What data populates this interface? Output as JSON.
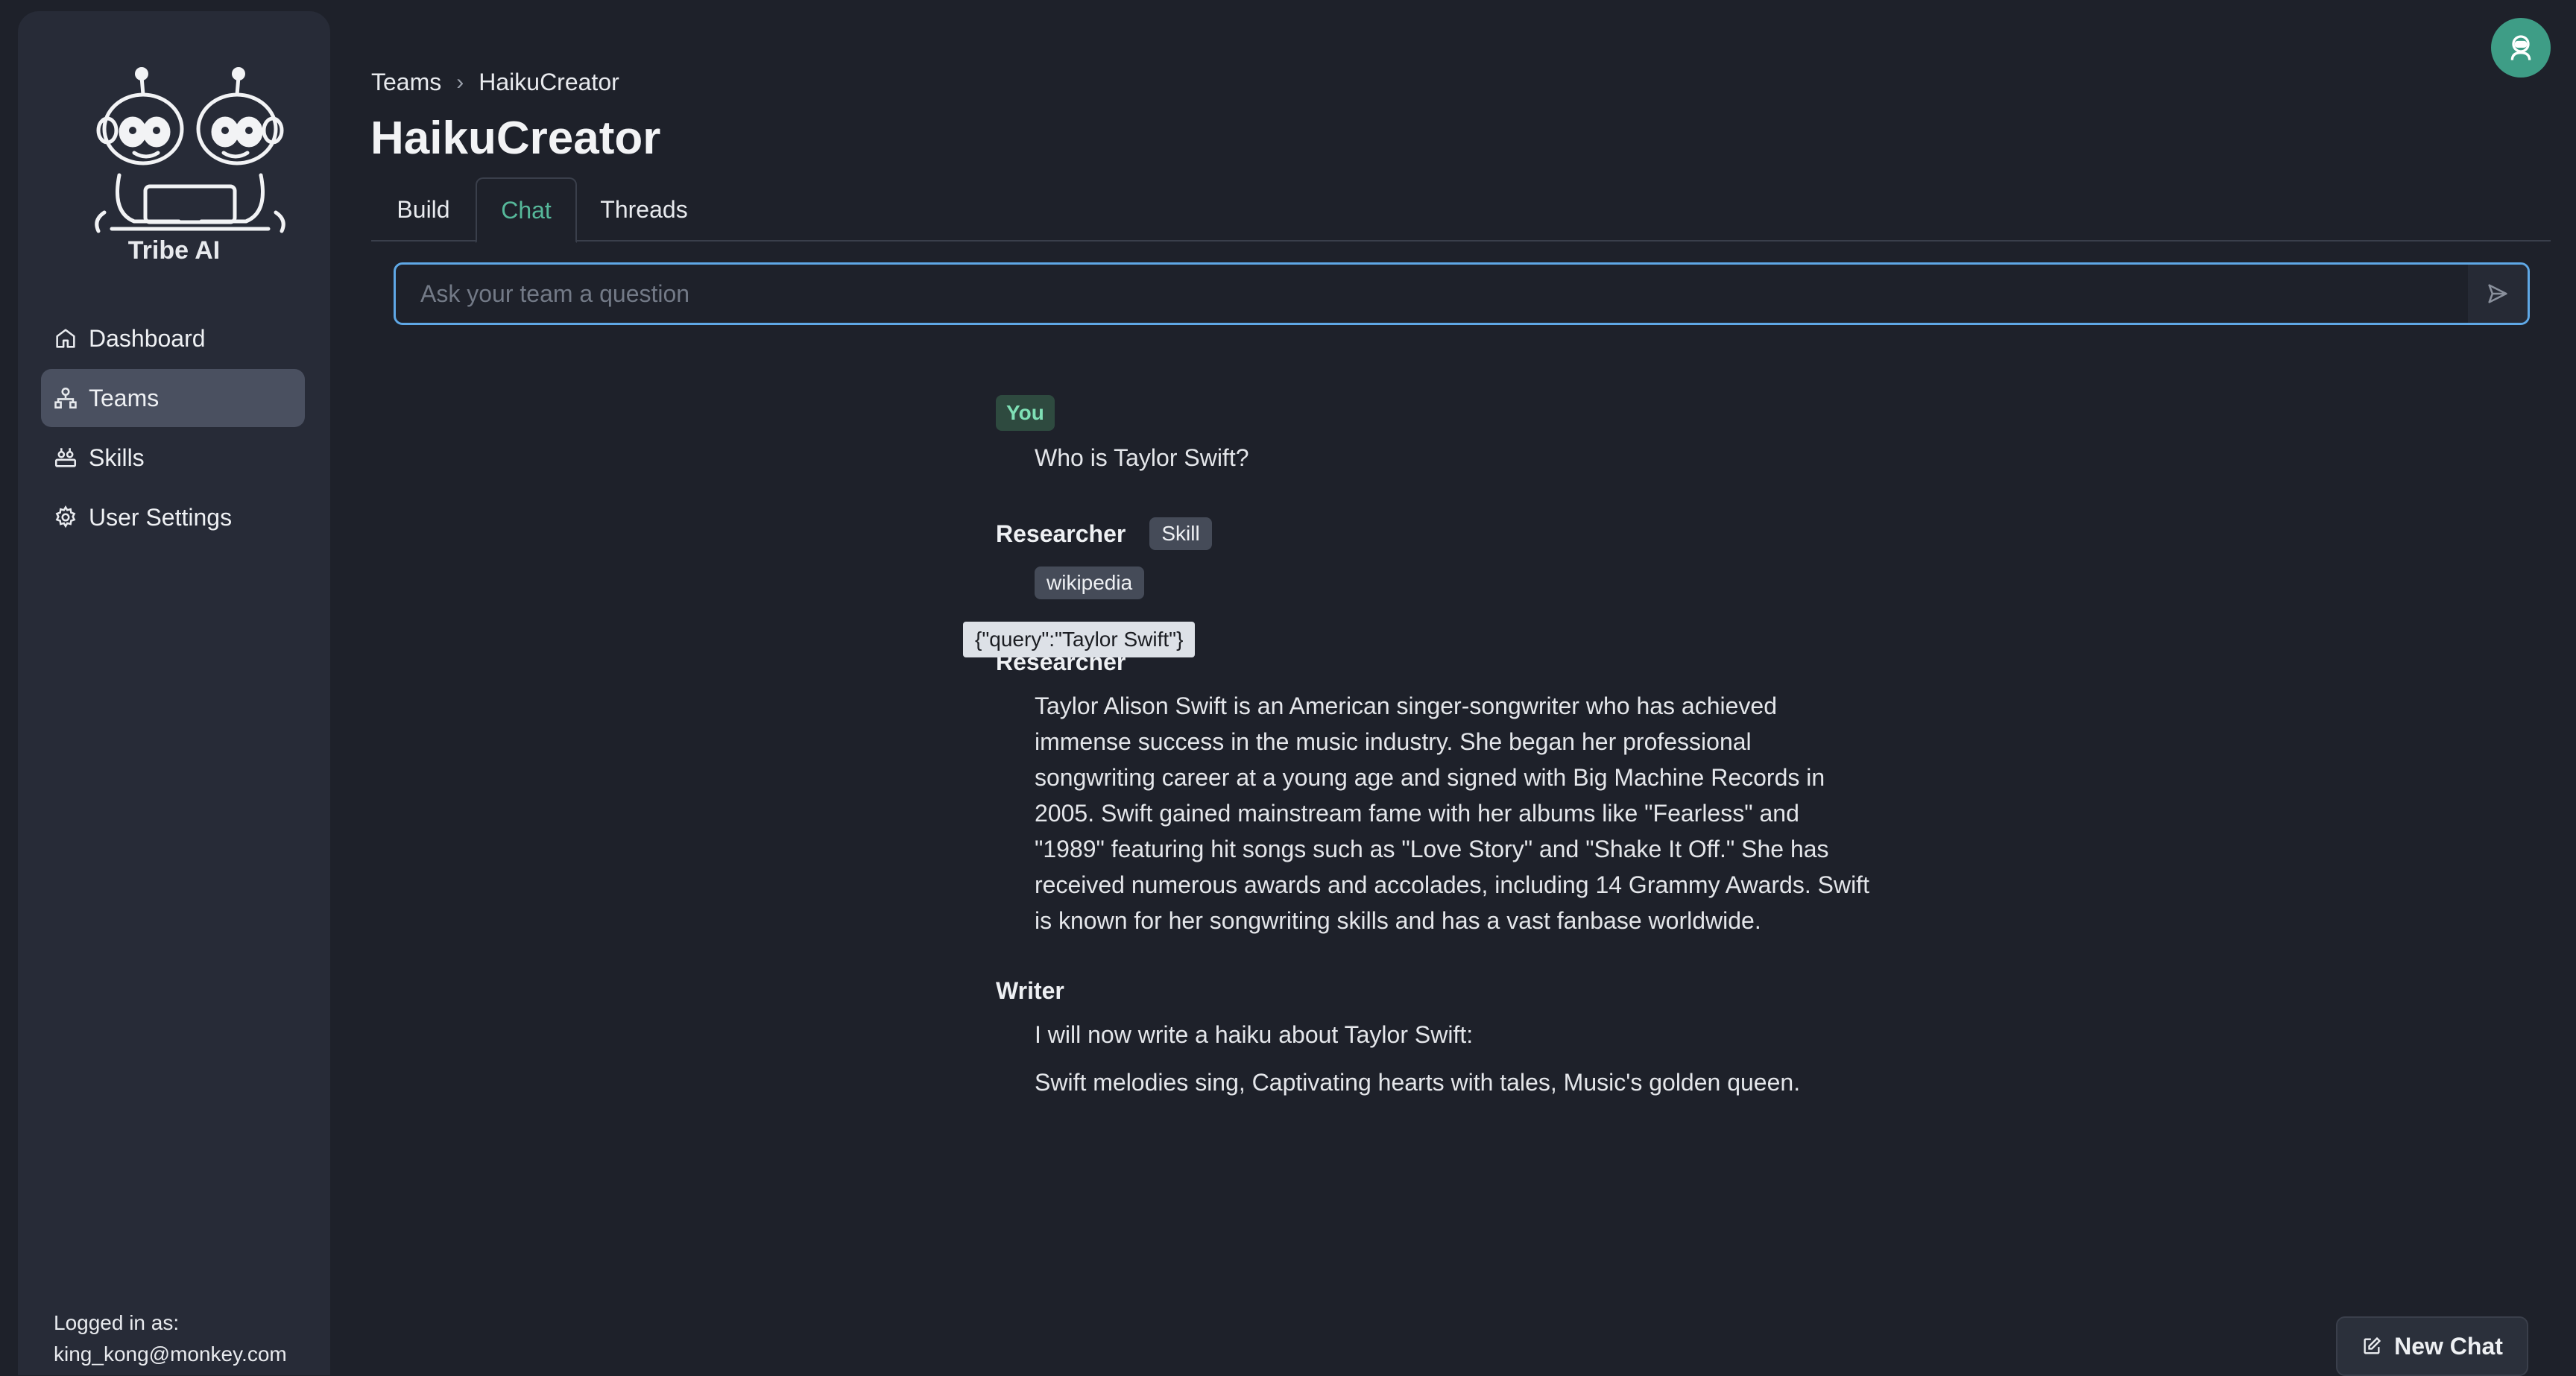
{
  "app": {
    "brand": "Tribe AI"
  },
  "sidebar": {
    "items": [
      {
        "label": "Dashboard",
        "icon": "home-icon",
        "active": false
      },
      {
        "label": "Teams",
        "icon": "teams-icon",
        "active": true
      },
      {
        "label": "Skills",
        "icon": "skills-icon",
        "active": false
      },
      {
        "label": "User Settings",
        "icon": "gear-icon",
        "active": false
      }
    ],
    "login_label": "Logged in as:",
    "login_email": "king_kong@monkey.com"
  },
  "breadcrumb": {
    "parent": "Teams",
    "current": "HaikuCreator"
  },
  "page_title": "HaikuCreator",
  "tabs": [
    {
      "label": "Build",
      "active": false
    },
    {
      "label": "Chat",
      "active": true
    },
    {
      "label": "Threads",
      "active": false
    }
  ],
  "ask": {
    "placeholder": "Ask your team a question",
    "value": ""
  },
  "chat": {
    "you_label": "You",
    "you_message": "Who is Taylor Swift?",
    "skill_sender": "Researcher",
    "skill_badge": "Skill",
    "skill_name": "wikipedia",
    "skill_query": "{\"query\":\"Taylor Swift\"}",
    "researcher_sender": "Researcher",
    "researcher_message_lines": [
      "Taylor Alison Swift is an American singer-songwriter who has achieved",
      "immense success in the music industry. She began her professional",
      "songwriting career at a young age and signed with Big Machine Records in",
      "2005. Swift gained mainstream fame with her albums like \"Fearless\" and",
      "\"1989\" featuring hit songs such as \"Love Story\" and \"Shake It Off.\" She has",
      "received numerous awards and accolades, including 14 Grammy Awards. Swift",
      "is known for her songwriting skills and has a vast fanbase worldwide."
    ],
    "writer_sender": "Writer",
    "writer_message_1": "I will now write a haiku about Taylor Swift:",
    "writer_message_2": "Swift melodies sing, Captivating hearts with tales, Music's golden queen."
  },
  "new_chat_label": "New Chat",
  "colors": {
    "accent": "#56b89a",
    "focus": "#5fa8e6",
    "avatar": "#3e9d86"
  }
}
